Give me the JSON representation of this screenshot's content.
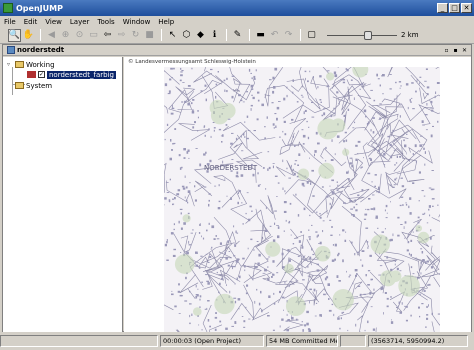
{
  "window": {
    "title": "OpenJUMP"
  },
  "menu": [
    "File",
    "Edit",
    "View",
    "Layer",
    "Tools",
    "Window",
    "Help"
  ],
  "toolbar": {
    "buttons": [
      {
        "name": "zoom-tool",
        "glyph": "🔍",
        "selected": true
      },
      {
        "name": "pan-tool",
        "glyph": "✋"
      },
      {
        "name": "zoom-previous",
        "glyph": "◀"
      },
      {
        "name": "zoom-to-full",
        "glyph": "⊕"
      },
      {
        "name": "zoom-to-selected",
        "glyph": "⊙"
      },
      {
        "name": "zoom-to-fence",
        "glyph": "▭"
      },
      {
        "name": "back",
        "glyph": "⇦"
      },
      {
        "name": "forward",
        "glyph": "⇨"
      },
      {
        "name": "refresh",
        "glyph": "↻"
      },
      {
        "name": "stop",
        "glyph": "■"
      },
      {
        "name": "select-tool",
        "glyph": "↖"
      },
      {
        "name": "fence-tool",
        "glyph": "⬡"
      },
      {
        "name": "feature-info",
        "glyph": "◆"
      },
      {
        "name": "info-tool",
        "glyph": "ℹ"
      },
      {
        "name": "edit-tool",
        "glyph": "✎"
      },
      {
        "name": "measure-tool",
        "glyph": "▬"
      },
      {
        "name": "undo",
        "glyph": "↶"
      },
      {
        "name": "redo",
        "glyph": "↷"
      },
      {
        "name": "window-tool",
        "glyph": "▢"
      }
    ],
    "scale_label": "2 km",
    "scale_fraction": 0.6
  },
  "project": {
    "title": "norderstedt",
    "controls": [
      "▫",
      "▪",
      "✕"
    ]
  },
  "layers": {
    "categories": [
      {
        "name": "Working",
        "layers": [
          {
            "name": "norderstedt_farbig",
            "visible": true
          }
        ]
      },
      {
        "name": "System",
        "layers": []
      }
    ]
  },
  "map": {
    "copyright": "© Landesvermessungsamt Schleswig-Holstein",
    "place_label": "NORDERSTEDT"
  },
  "status": {
    "message": "",
    "time": "00:00:03 (Open Project)",
    "memory": "54 MB Committed Me...",
    "blank": "",
    "coords": "(3563714, 5950994.2)"
  }
}
